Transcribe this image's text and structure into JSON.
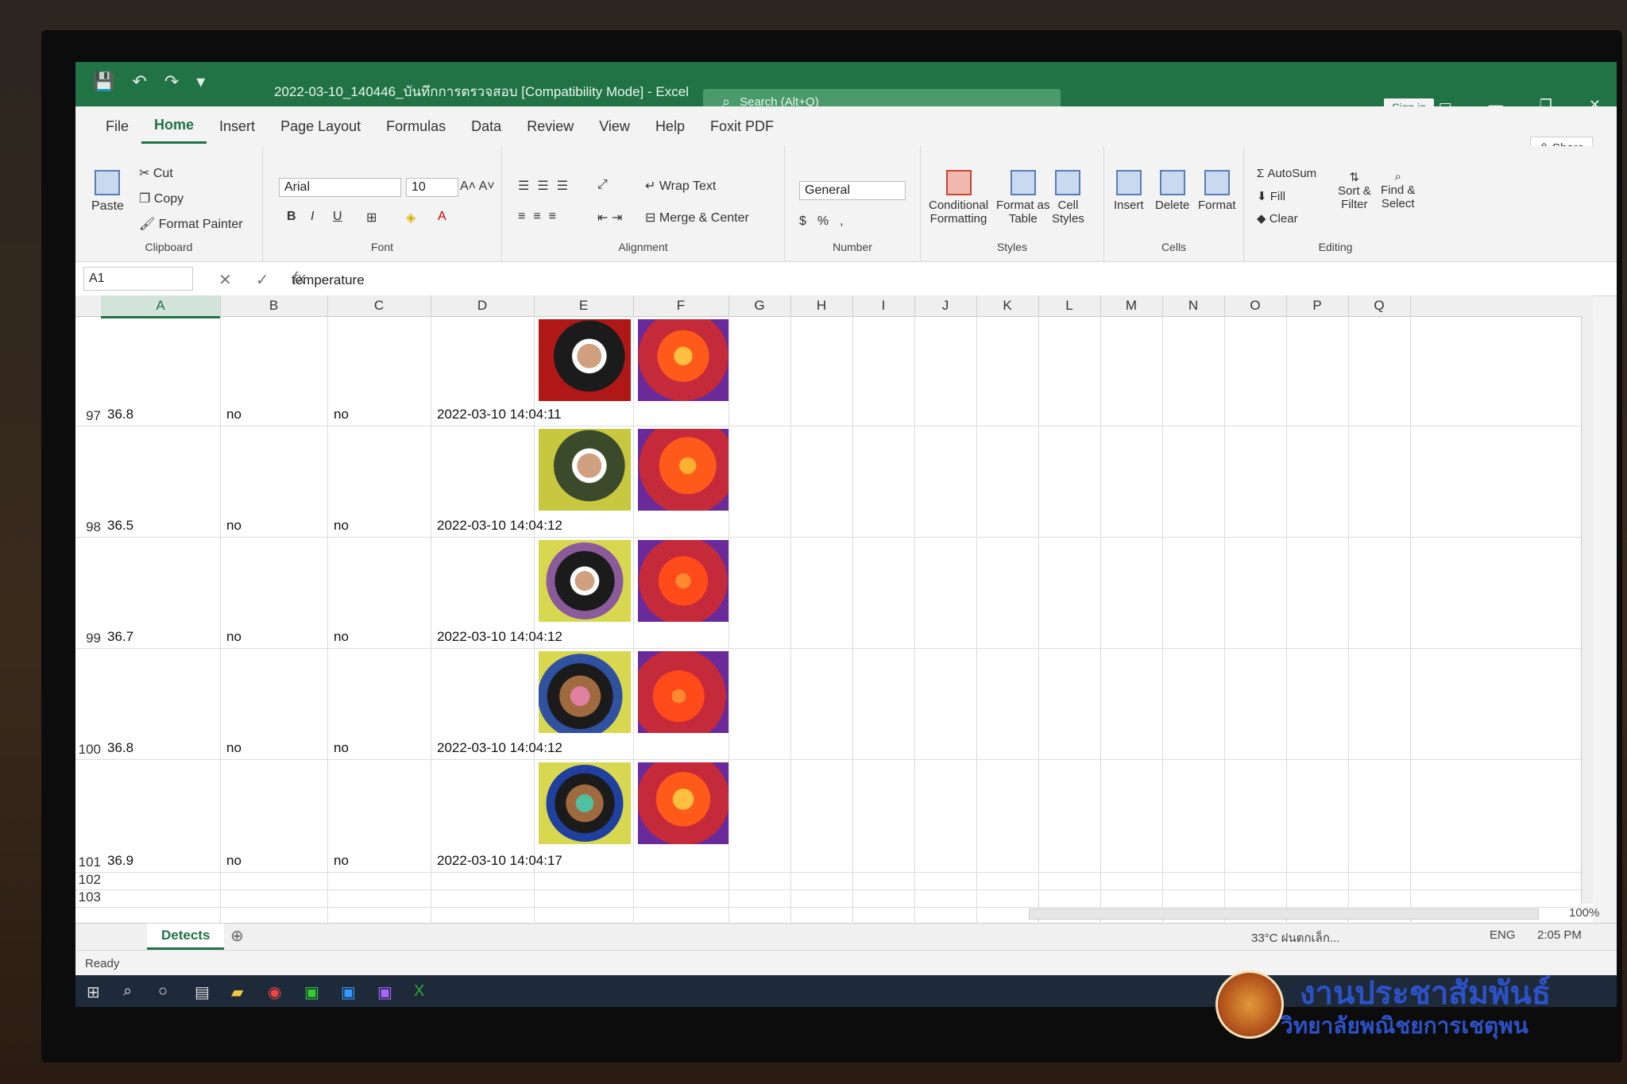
{
  "window": {
    "title": "2022-03-10_140446_บันทึกการตรวจสอบ [Compatibility Mode] - Excel",
    "search_placeholder": "Search (Alt+Q)",
    "signin_label": "Sign in",
    "share_label": "Share"
  },
  "tabs": [
    "File",
    "Home",
    "Insert",
    "Page Layout",
    "Formulas",
    "Data",
    "Review",
    "View",
    "Help",
    "Foxit PDF"
  ],
  "ribbon": {
    "clipboard": {
      "label": "Clipboard",
      "paste": "Paste",
      "cut": "Cut",
      "copy": "Copy",
      "format_painter": "Format Painter"
    },
    "font": {
      "label": "Font",
      "name": "Arial",
      "size": "10"
    },
    "alignment": {
      "label": "Alignment",
      "wrap_text": "Wrap Text",
      "merge_center": "Merge & Center"
    },
    "number": {
      "label": "Number",
      "format": "General"
    },
    "styles": {
      "label": "Styles",
      "conditional": "Conditional",
      "formatting": "Formatting",
      "format_as": "Format as",
      "table": "Table",
      "cell": "Cell",
      "styles": "Styles"
    },
    "cells": {
      "label": "Cells",
      "insert": "Insert",
      "delete": "Delete",
      "format": "Format"
    },
    "editing": {
      "label": "Editing",
      "autosum": "AutoSum",
      "fill": "Fill",
      "clear": "Clear",
      "sort": "Sort &",
      "filter": "Filter",
      "find": "Find &",
      "select": "Select"
    }
  },
  "formula_bar": {
    "name_box": "A1",
    "fx": "fx",
    "value": "temperature"
  },
  "columns": [
    "A",
    "B",
    "C",
    "D",
    "E",
    "F",
    "G",
    "H",
    "I",
    "J",
    "K",
    "L",
    "M",
    "N",
    "O",
    "P",
    "Q"
  ],
  "rows": [
    {
      "num": "97",
      "a": "36.8",
      "b": "no",
      "c": "no",
      "d": "2022-03-10 14:04:11"
    },
    {
      "num": "98",
      "a": "36.5",
      "b": "no",
      "c": "no",
      "d": "2022-03-10 14:04:12"
    },
    {
      "num": "99",
      "a": "36.7",
      "b": "no",
      "c": "no",
      "d": "2022-03-10 14:04:12"
    },
    {
      "num": "100",
      "a": "36.8",
      "b": "no",
      "c": "no",
      "d": "2022-03-10 14:04:12"
    },
    {
      "num": "101",
      "a": "36.9",
      "b": "no",
      "c": "no",
      "d": "2022-03-10 14:04:17"
    }
  ],
  "empty_rows": [
    "102",
    "103"
  ],
  "sheet_tab": "Detects",
  "status": {
    "ready": "Ready",
    "weather": "33°C ฝนตกเล็ก...",
    "lang": "ENG",
    "time": "2:05 PM",
    "zoom": "100%"
  },
  "watermark": {
    "line1": "งานประชาสัมพันธ์",
    "line2": "วิทยาลัยพณิชยการเชตุพน"
  },
  "colors": {
    "excel_green": "#217346",
    "taskbar": "#1e2a3a",
    "watermark_blue": "#2c52c8"
  }
}
